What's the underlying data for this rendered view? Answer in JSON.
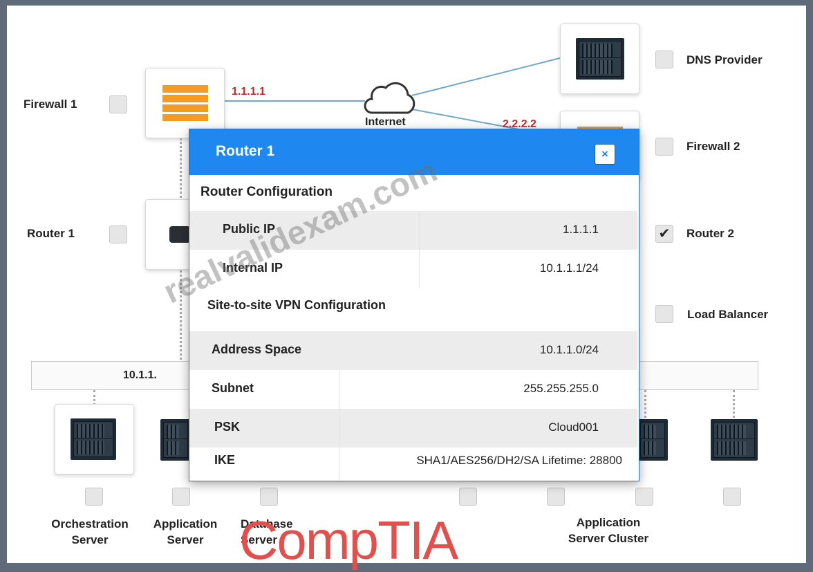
{
  "devices": {
    "firewall1": {
      "label": "Firewall 1",
      "ip": "1.1.1.1"
    },
    "internet": {
      "label": "Internet"
    },
    "dns_provider": {
      "label": "DNS Provider"
    },
    "firewall2": {
      "label": "Firewall 2",
      "ip": "2.2.2.2"
    },
    "router1": {
      "label": "Router 1"
    },
    "router2": {
      "label": "Router 2",
      "checked": true,
      "check_glyph": "✔"
    },
    "load_balancer": {
      "label": "Load Balancer"
    }
  },
  "network_bar": {
    "label": "10.1.1."
  },
  "servers": [
    {
      "label": "Orchestration Server"
    },
    {
      "label": "Application Server"
    },
    {
      "label": "Database Server"
    },
    {
      "label": "Application Server Cluster"
    }
  ],
  "modal": {
    "title": "Router 1",
    "close_glyph": "×",
    "router_config": {
      "heading": "Router Configuration",
      "rows": [
        {
          "key": "Public IP",
          "value": "1.1.1.1"
        },
        {
          "key": "Internal IP",
          "value": "10.1.1.1/24"
        }
      ]
    },
    "vpn_config": {
      "heading": "Site-to-site VPN Configuration",
      "rows": [
        {
          "key": "Address Space",
          "value": "10.1.1.0/24"
        },
        {
          "key": "Subnet",
          "value": "255.255.255.0"
        },
        {
          "key": "PSK",
          "value": "Cloud001"
        },
        {
          "key": "IKE",
          "value": "SHA1/AES256/DH2/SA Lifetime: 28800"
        }
      ]
    }
  },
  "watermark": "realvalidexam.com",
  "brand": "CompTIA",
  "colors": {
    "accent": "#1e88f0",
    "ip_red": "#c0282d",
    "firewall_orange": "#f39b23",
    "brand_red": "#e0504d"
  },
  "icons": [
    "firewall-icon",
    "cloud-icon",
    "server-icon",
    "router-icon",
    "checkbox-icon",
    "close-icon"
  ]
}
